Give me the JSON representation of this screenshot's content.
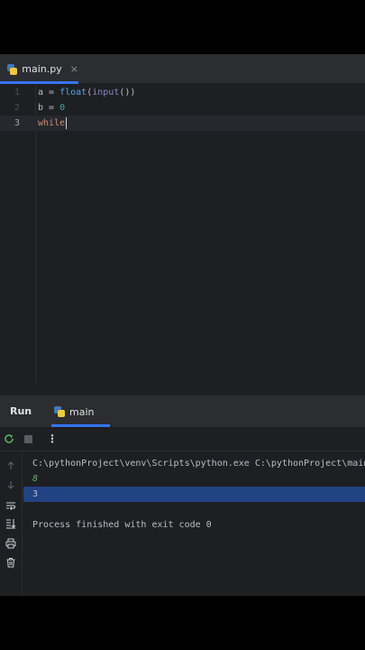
{
  "editor_tab": {
    "filename": "main.py",
    "close_glyph": "×",
    "icon": "python-file-icon"
  },
  "editor": {
    "lines": [
      {
        "number": "1",
        "tokens": [
          "a = ",
          "float",
          "(",
          "input",
          "())"
        ]
      },
      {
        "number": "2",
        "tokens": [
          "b = ",
          "0"
        ]
      },
      {
        "number": "3",
        "tokens": [
          "while"
        ]
      }
    ],
    "current_line": 3
  },
  "run_panel": {
    "title": "Run",
    "tab_label": "main",
    "tab_icon": "python-file-icon",
    "toolbar": {
      "rerun_icon": "rerun-icon",
      "stop_icon": "stop-icon",
      "more_glyph": "⋮"
    },
    "sidebar_icons": [
      "up-arrow-icon",
      "down-arrow-icon",
      "soft-wrap-icon",
      "scroll-to-end-icon",
      "print-icon",
      "trash-icon"
    ],
    "console": {
      "command": "C:\\pythonProject\\venv\\Scripts\\python.exe C:\\pythonProject\\main.py",
      "user_input": "8",
      "output": "3",
      "exit_message": "Process finished with exit code 0"
    }
  },
  "colors": {
    "background": "#1e1f22",
    "panel": "#2b2d30",
    "accent": "#3574f0",
    "keyword": "#cf8e6d",
    "number": "#2aacb8",
    "function": "#56a8f5",
    "builtin": "#8888c6",
    "input_text": "#5fb865",
    "selection": "#214283"
  }
}
